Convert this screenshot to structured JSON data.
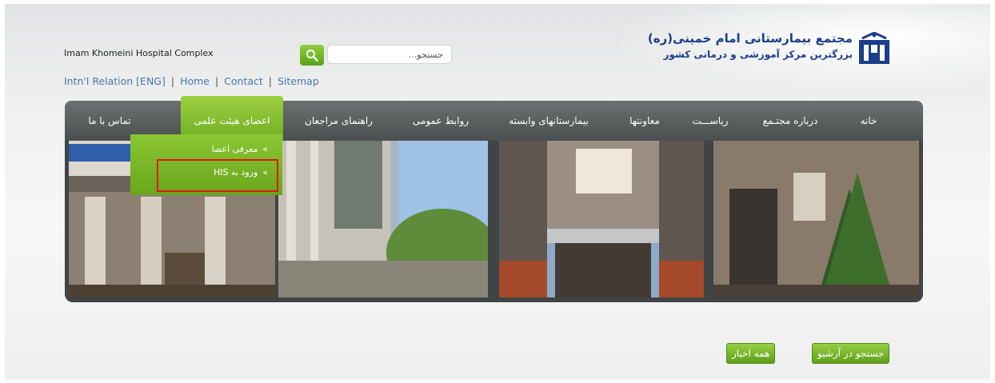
{
  "site_title": "Imam Khomeini Hospital Complex",
  "top_links": {
    "intl": "Intn'l Relation [ENG]",
    "home": "Home",
    "contact": "Contact",
    "sitemap": "Sitemap",
    "separator": "|"
  },
  "search": {
    "placeholder": "جستجو...",
    "button_icon": "search-icon"
  },
  "logo": {
    "title": "مجتمع بیمارستانی امام خمینی(ره)",
    "subtitle": "بزرگترین مرکز آموزشی و درمانی کشور"
  },
  "nav": {
    "items": [
      "خانه",
      "درباره مجتـمع",
      "ریاســـت",
      "معاونتها",
      "بیمارستانهای وابسته",
      "روابط عمومی",
      "راهنمای مراجعان",
      "اعضای هیئت علمی",
      "تماس با ما"
    ],
    "active_index": 7
  },
  "dropdown": {
    "items": [
      "معرفی اعضا",
      "ورود به HIS"
    ]
  },
  "buttons": {
    "archive_search": "جستجو در آرشیو",
    "all_news": "همه اخبار"
  },
  "colors": {
    "accent_green": "#7ab82a",
    "nav_dark": "#565b5c",
    "logo_blue": "#1a3f8a",
    "highlight_red": "#e01818"
  }
}
